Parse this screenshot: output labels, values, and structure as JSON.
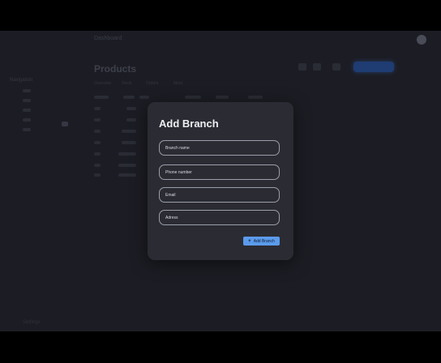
{
  "background": {
    "app_title": "Dashboard",
    "page_title": "Products",
    "sidebar_heading": "Navigation",
    "sidebar_footer": "Settings",
    "tabs": [
      "Overview",
      "Stock",
      "Orders",
      "More"
    ]
  },
  "modal": {
    "title": "Add Branch",
    "fields": {
      "branch_name": {
        "placeholder": "Branch name",
        "value": ""
      },
      "phone": {
        "placeholder": "Phone number",
        "value": ""
      },
      "email": {
        "placeholder": "Email",
        "value": ""
      },
      "address": {
        "placeholder": "Adress",
        "value": ""
      }
    },
    "submit": {
      "label": "Add Branch",
      "icon": "plus-icon"
    }
  },
  "colors": {
    "accent": "#5b9bec",
    "modal_bg": "#2b2c33",
    "page_bg": "#1c1d24"
  }
}
